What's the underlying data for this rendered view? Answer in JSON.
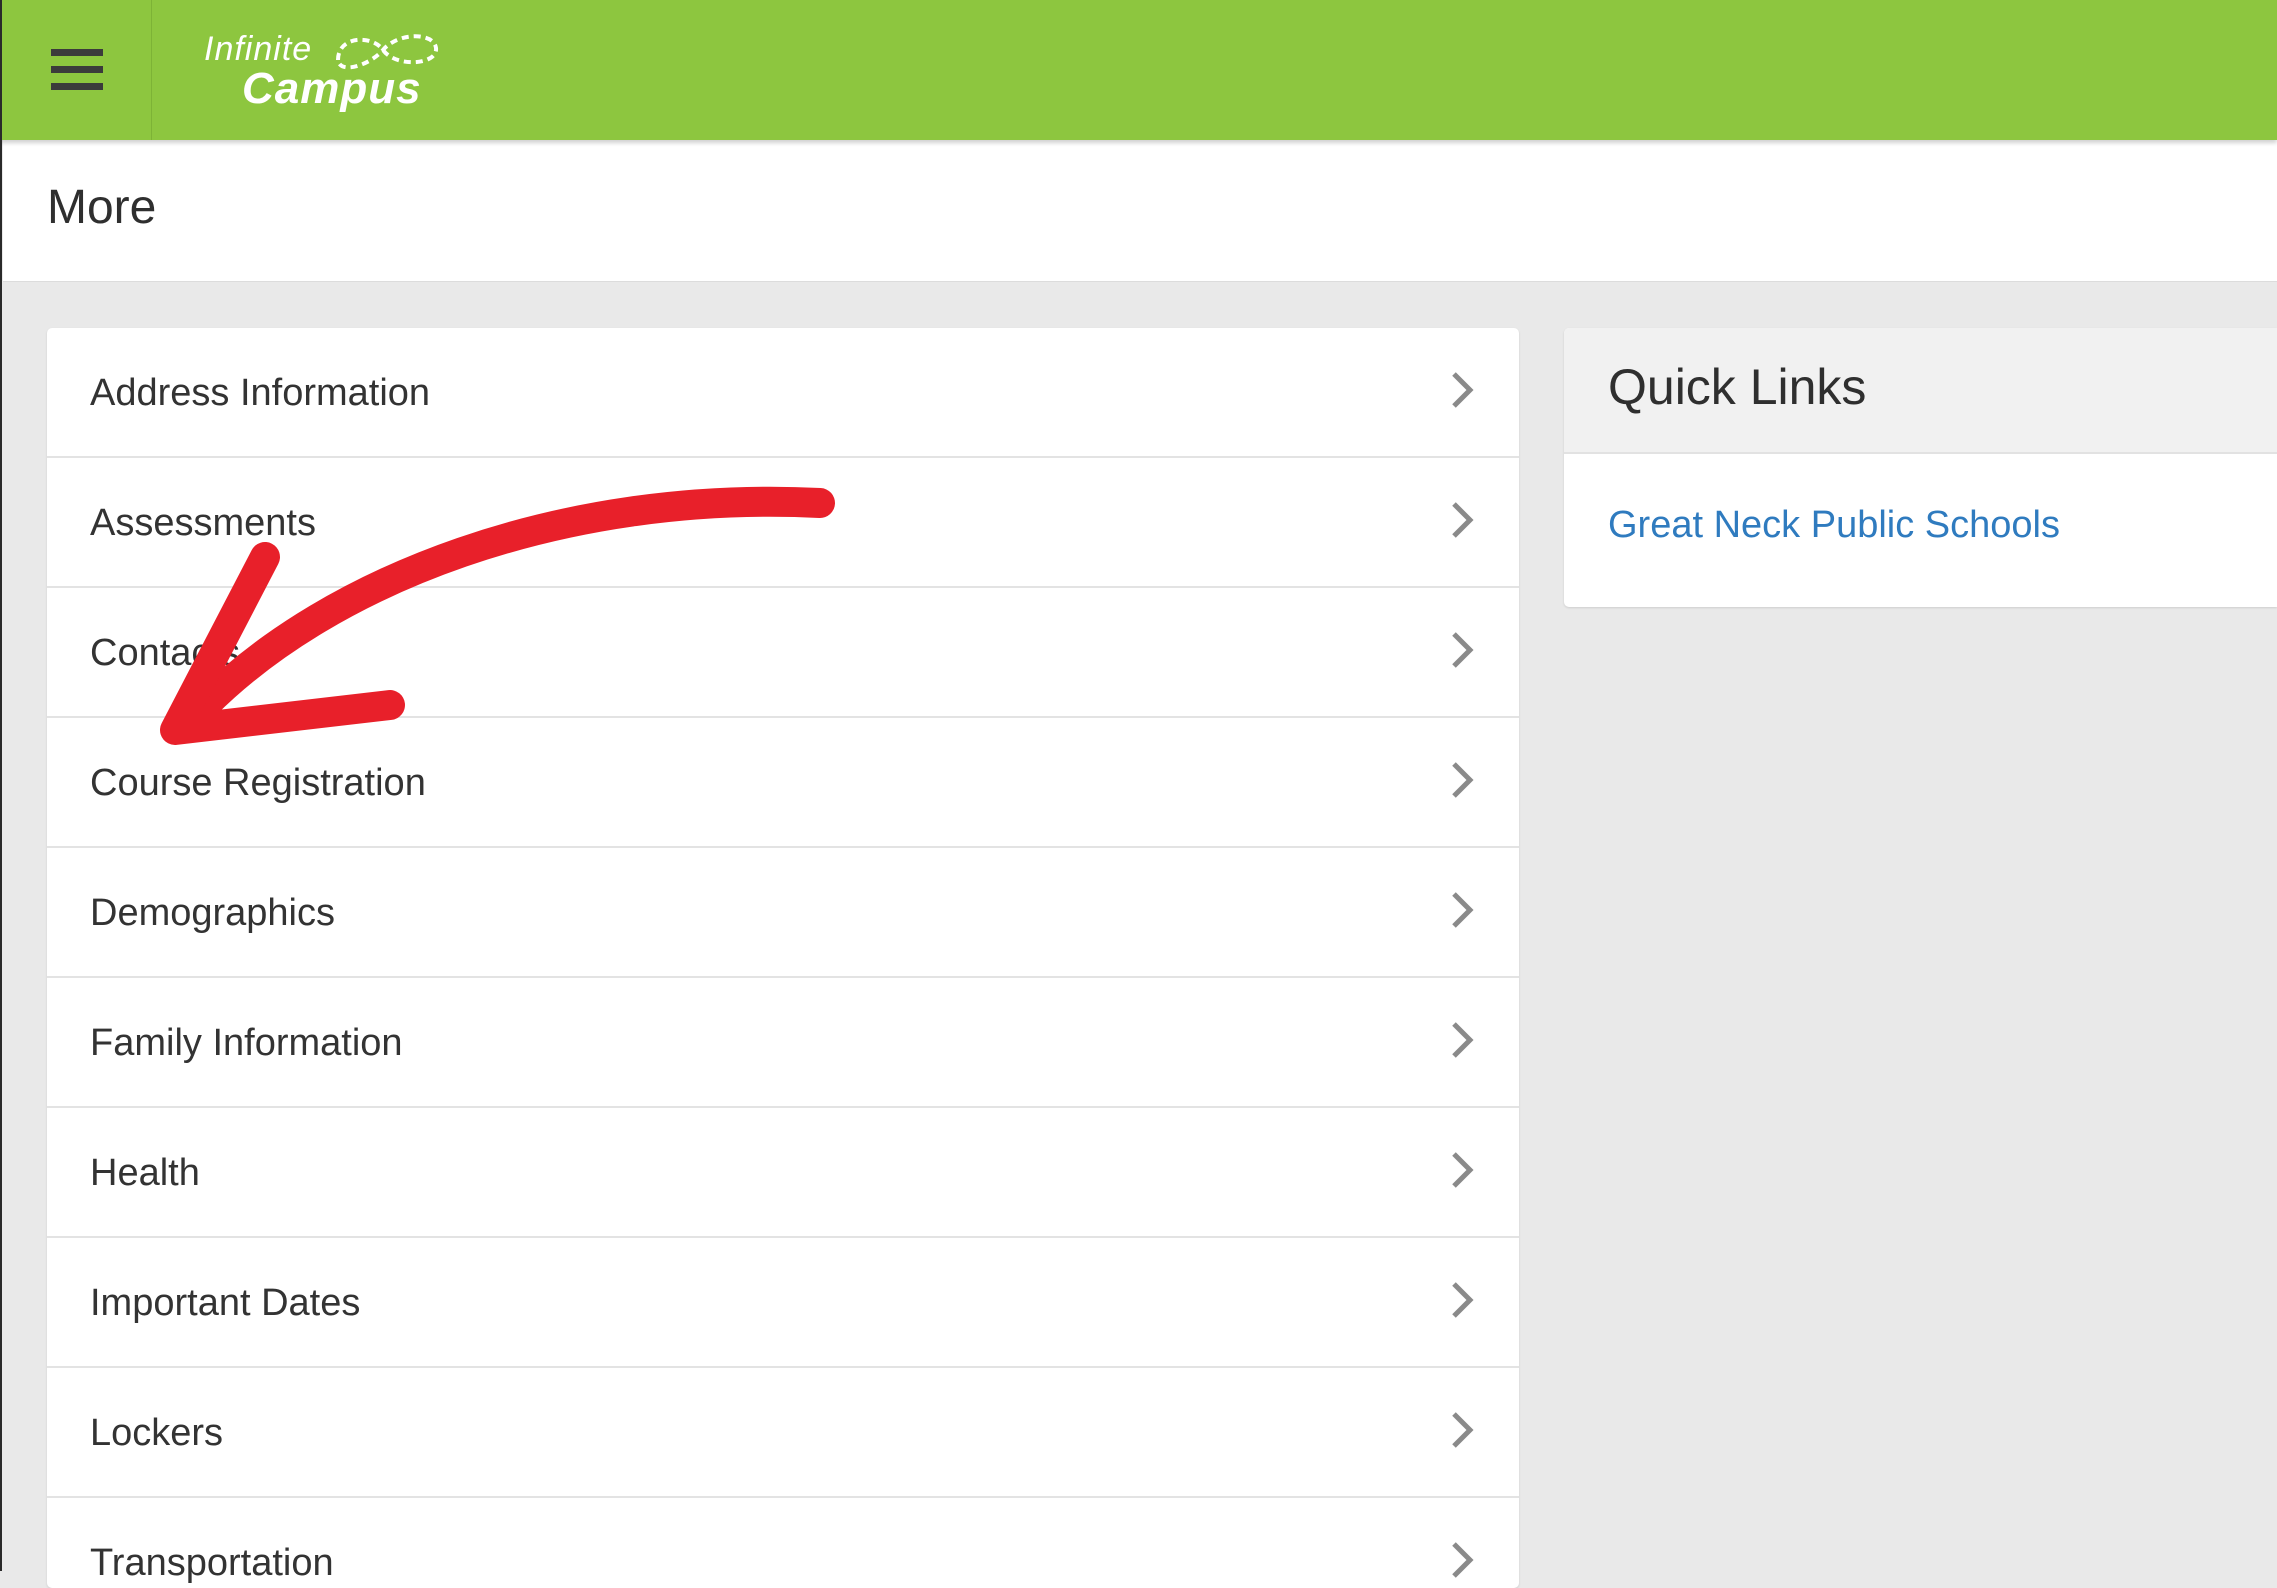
{
  "header": {
    "logo_line1": "Infinite",
    "logo_line2": "Campus",
    "brand_color": "#8dc63f"
  },
  "page": {
    "title": "More"
  },
  "nav": {
    "items": [
      {
        "label": "Address Information"
      },
      {
        "label": "Assessments"
      },
      {
        "label": "Contacts"
      },
      {
        "label": "Course Registration"
      },
      {
        "label": "Demographics"
      },
      {
        "label": "Family Information"
      },
      {
        "label": "Health"
      },
      {
        "label": "Important Dates"
      },
      {
        "label": "Lockers"
      },
      {
        "label": "Transportation"
      }
    ]
  },
  "quick_links": {
    "title": "Quick Links",
    "links": [
      {
        "label": "Great Neck Public Schools"
      }
    ],
    "link_color": "#2f7bbf"
  },
  "annotation": {
    "color": "#e8202a",
    "icon": "red-arrow-icon"
  }
}
